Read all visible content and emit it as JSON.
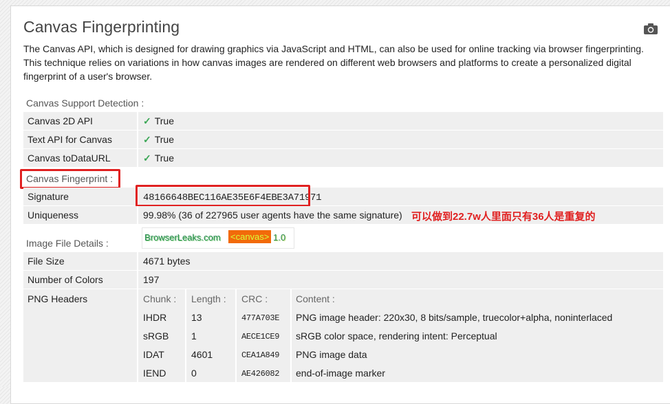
{
  "title": "Canvas Fingerprinting",
  "description": "The Canvas API, which is designed for drawing graphics via JavaScript and HTML, can also be used for online tracking via browser fingerprinting. This technique relies on variations in how canvas images are rendered on different web browsers and platforms to create a personalized digital fingerprint of a user's browser.",
  "support": {
    "label": "Canvas Support Detection :",
    "rows": [
      {
        "key": "Canvas 2D API",
        "value": "True"
      },
      {
        "key": "Text API for Canvas",
        "value": "True"
      },
      {
        "key": "Canvas toDataURL",
        "value": "True"
      }
    ],
    "check_glyph": "✓"
  },
  "fingerprint": {
    "label": "Canvas Fingerprint :",
    "signature_key": "Signature",
    "signature_value": "48166648BEC116AE35E6F4EBE3A71971",
    "uniqueness_key": "Uniqueness",
    "uniqueness_value": "99.98% (36 of 227965 user agents have the same signature)",
    "annotation": "可以做到22.7w人里面只有36人是重复的"
  },
  "image_details": {
    "label": "Image File Details :",
    "canvas_text_1": "BrowserLeaks.com",
    "canvas_text_2": "<canvas>",
    "canvas_text_3": "1.0",
    "file_size_key": "File Size",
    "file_size_value": "4671 bytes",
    "colors_key": "Number of Colors",
    "colors_value": "197",
    "png_headers_key": "PNG Headers",
    "png_columns": [
      "Chunk :",
      "Length :",
      "CRC :",
      "Content :"
    ],
    "png_rows": [
      {
        "chunk": "IHDR",
        "length": "13",
        "crc": "477A703E",
        "content": "PNG image header: 220x30, 8 bits/sample, truecolor+alpha, noninterlaced"
      },
      {
        "chunk": "sRGB",
        "length": "1",
        "crc": "AECE1CE9",
        "content": "sRGB color space, rendering intent: Perceptual"
      },
      {
        "chunk": "IDAT",
        "length": "4601",
        "crc": "CEA1A849",
        "content": "PNG image data"
      },
      {
        "chunk": "IEND",
        "length": "0",
        "crc": "AE426082",
        "content": "end-of-image marker"
      }
    ]
  },
  "colors": {
    "check": "#3aa655",
    "highlight": "#e02020",
    "row_bg": "#efefef"
  },
  "icons": {
    "camera": "camera-icon"
  }
}
